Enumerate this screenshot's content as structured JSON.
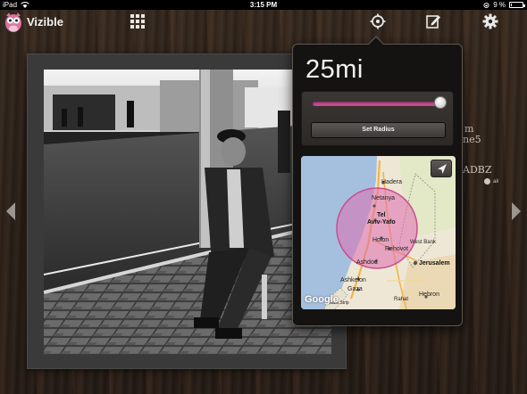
{
  "status_bar": {
    "device": "iPad",
    "time": "3:15 PM",
    "battery": "9 %",
    "battery_level": 0.09
  },
  "app": {
    "name": "Vizible"
  },
  "icons": {
    "logo": "owl-logo-icon",
    "grid": "grid-icon",
    "location": "crosshair-location-icon",
    "compose": "compose-icon",
    "settings": "gear-icon",
    "prev": "chevron-left-icon",
    "next": "chevron-right-icon",
    "locate": "location-arrow-icon"
  },
  "background_info": {
    "line1": "m",
    "line2": "ne5",
    "line3": "ADBZ",
    "meta": "ak"
  },
  "popover": {
    "radius_value": "25mi",
    "slider_fraction": 0.97,
    "set_radius_label": "Set Radius",
    "map": {
      "labels": [
        "Hadera",
        "Netanya",
        "Tel",
        "Aviv-Yafo",
        "Holon",
        "Rehovot",
        "Ashdod",
        "West Bank",
        "Jerusalem",
        "Ashkelon",
        "Gaza",
        "Hebron",
        "Rahat",
        "Gaza Strip"
      ],
      "attribution": "Google",
      "radius_color": "#e06bb0"
    }
  },
  "colors": {
    "accent": "#c94d91",
    "slider_track": "#c94d91"
  }
}
